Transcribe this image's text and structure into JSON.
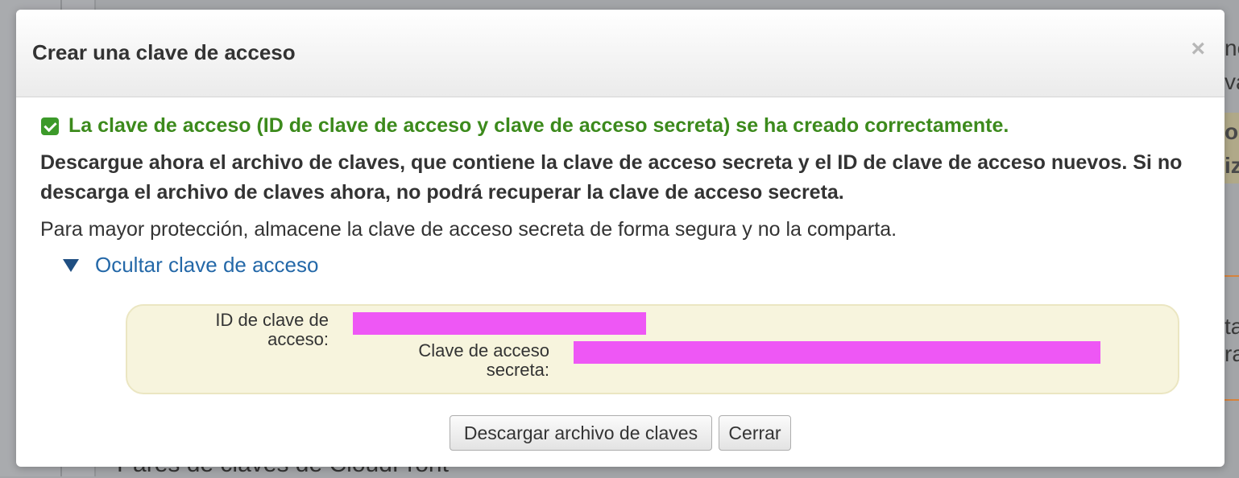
{
  "background": {
    "right_fragments": [
      "ne",
      "va",
      "o s",
      "iz",
      "ta",
      "ra"
    ],
    "bottom_fragment": "– Pares de claves de CloudFront"
  },
  "modal": {
    "title": "Crear una clave de acceso",
    "close_glyph": "×",
    "success_message": "La clave de acceso (ID de clave de acceso y clave de acceso secreta) se ha creado correctamente.",
    "warning": "Descargue ahora el archivo de claves, que contiene la clave de acceso secreta y el ID de clave de acceso nuevos. Si no descarga el archivo de claves ahora, no podrá recuperar la clave de acceso secreta.",
    "protection_note": "Para mayor protección, almacene la clave de acceso secreta de forma segura y no la comparta.",
    "toggle_label": "Ocultar clave de acceso",
    "key_panel": {
      "access_key_id_label": "ID de clave de acceso:",
      "secret_key_label": "Clave de acceso secreta:"
    },
    "buttons": {
      "download": "Descargar archivo de claves",
      "close": "Cerrar"
    }
  },
  "colors": {
    "success": "#3c8a1c",
    "link": "#2468a8",
    "redaction": "#ee57f5",
    "panel_bg": "#f7f4dd"
  }
}
